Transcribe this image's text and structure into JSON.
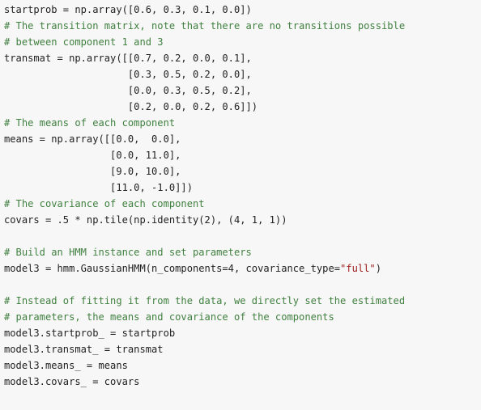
{
  "editor": {
    "background_color": "#f7f7f7",
    "code_color": "#222222",
    "comment_color": "#408040",
    "string_color": "#a02020",
    "language": "python",
    "font_size_px": 12,
    "line_height_px": 20
  },
  "code": {
    "lines": [
      {
        "index": 1,
        "text": "startprob = np.array([0.6, 0.3, 0.1, 0.0])",
        "tokens": [
          {
            "type": "code",
            "text": "startprob = np.array([0.6, 0.3, 0.1, 0.0])"
          }
        ]
      },
      {
        "index": 2,
        "text": "# The transition matrix, note that there are no transitions possible",
        "tokens": [
          {
            "type": "comment",
            "text": "# The transition matrix, note that there are no transitions possible"
          }
        ]
      },
      {
        "index": 3,
        "text": "# between component 1 and 3",
        "tokens": [
          {
            "type": "comment",
            "text": "# between component 1 and 3"
          }
        ]
      },
      {
        "index": 4,
        "text": "transmat = np.array([[0.7, 0.2, 0.0, 0.1],",
        "tokens": [
          {
            "type": "code",
            "text": "transmat = np.array([[0.7, 0.2, 0.0, 0.1],"
          }
        ]
      },
      {
        "index": 5,
        "text": "                     [0.3, 0.5, 0.2, 0.0],",
        "tokens": [
          {
            "type": "code",
            "text": "                     [0.3, 0.5, 0.2, 0.0],"
          }
        ]
      },
      {
        "index": 6,
        "text": "                     [0.0, 0.3, 0.5, 0.2],",
        "tokens": [
          {
            "type": "code",
            "text": "                     [0.0, 0.3, 0.5, 0.2],"
          }
        ]
      },
      {
        "index": 7,
        "text": "                     [0.2, 0.0, 0.2, 0.6]])",
        "tokens": [
          {
            "type": "code",
            "text": "                     [0.2, 0.0, 0.2, 0.6]])"
          }
        ]
      },
      {
        "index": 8,
        "text": "# The means of each component",
        "tokens": [
          {
            "type": "comment",
            "text": "# The means of each component"
          }
        ]
      },
      {
        "index": 9,
        "text": "means = np.array([[0.0,  0.0],",
        "tokens": [
          {
            "type": "code",
            "text": "means = np.array([[0.0,  0.0],"
          }
        ]
      },
      {
        "index": 10,
        "text": "                  [0.0, 11.0],",
        "tokens": [
          {
            "type": "code",
            "text": "                  [0.0, 11.0],"
          }
        ]
      },
      {
        "index": 11,
        "text": "                  [9.0, 10.0],",
        "tokens": [
          {
            "type": "code",
            "text": "                  [9.0, 10.0],"
          }
        ]
      },
      {
        "index": 12,
        "text": "                  [11.0, -1.0]])",
        "tokens": [
          {
            "type": "code",
            "text": "                  [11.0, -1.0]])"
          }
        ]
      },
      {
        "index": 13,
        "text": "# The covariance of each component",
        "tokens": [
          {
            "type": "comment",
            "text": "# The covariance of each component"
          }
        ]
      },
      {
        "index": 14,
        "text": "covars = .5 * np.tile(np.identity(2), (4, 1, 1))",
        "tokens": [
          {
            "type": "code",
            "text": "covars = .5 * np.tile(np.identity(2), (4, 1, 1))"
          }
        ]
      },
      {
        "index": 15,
        "text": "",
        "tokens": []
      },
      {
        "index": 16,
        "text": "# Build an HMM instance and set parameters",
        "tokens": [
          {
            "type": "comment",
            "text": "# Build an HMM instance and set parameters"
          }
        ]
      },
      {
        "index": 17,
        "text": "model3 = hmm.GaussianHMM(n_components=4, covariance_type=\"full\")",
        "tokens": [
          {
            "type": "code",
            "text": "model3 = hmm.GaussianHMM(n_components=4, covariance_type="
          },
          {
            "type": "string",
            "text": "\"full\""
          },
          {
            "type": "code",
            "text": ")"
          }
        ]
      },
      {
        "index": 18,
        "text": "",
        "tokens": []
      },
      {
        "index": 19,
        "text": "# Instead of fitting it from the data, we directly set the estimated",
        "tokens": [
          {
            "type": "comment",
            "text": "# Instead of fitting it from the data, we directly set the estimated"
          }
        ]
      },
      {
        "index": 20,
        "text": "# parameters, the means and covariance of the components",
        "tokens": [
          {
            "type": "comment",
            "text": "# parameters, the means and covariance of the components"
          }
        ]
      },
      {
        "index": 21,
        "text": "model3.startprob_ = startprob",
        "tokens": [
          {
            "type": "code",
            "text": "model3.startprob_ = startprob"
          }
        ]
      },
      {
        "index": 22,
        "text": "model3.transmat_ = transmat",
        "tokens": [
          {
            "type": "code",
            "text": "model3.transmat_ = transmat"
          }
        ]
      },
      {
        "index": 23,
        "text": "model3.means_ = means",
        "tokens": [
          {
            "type": "code",
            "text": "model3.means_ = means"
          }
        ]
      },
      {
        "index": 24,
        "text": "model3.covars_ = covars",
        "tokens": [
          {
            "type": "code",
            "text": "model3.covars_ = covars"
          }
        ]
      }
    ]
  }
}
